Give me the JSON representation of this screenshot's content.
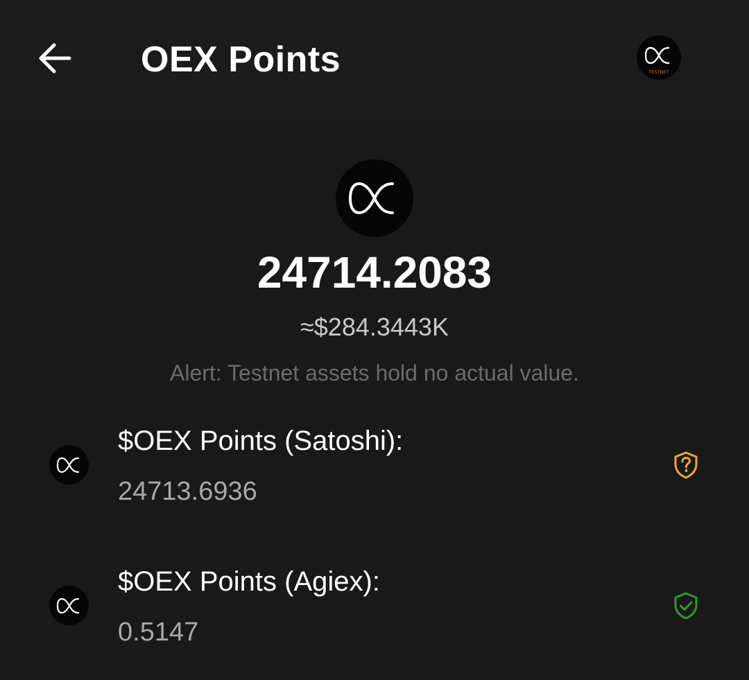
{
  "header": {
    "title": "OEX Points",
    "back_icon": "arrow-left-icon",
    "network_badge": "TESTNET"
  },
  "balance": {
    "amount": "24714.2083",
    "fiat": "≈$284.3443K",
    "alert": "Alert: Testnet assets hold no actual value."
  },
  "assets": [
    {
      "label": "$OEX Points (Satoshi):",
      "value": "24713.6936",
      "status_icon": "shield-question-icon",
      "status_color": "#f0a82c"
    },
    {
      "label": "$OEX Points (Agiex):",
      "value": "0.5147",
      "status_icon": "shield-check-icon",
      "status_color": "#2f9a32"
    }
  ],
  "colors": {
    "background": "#191919",
    "text_primary": "#ffffff",
    "text_secondary": "#a8a8a8",
    "text_muted": "#6b6b6b"
  }
}
